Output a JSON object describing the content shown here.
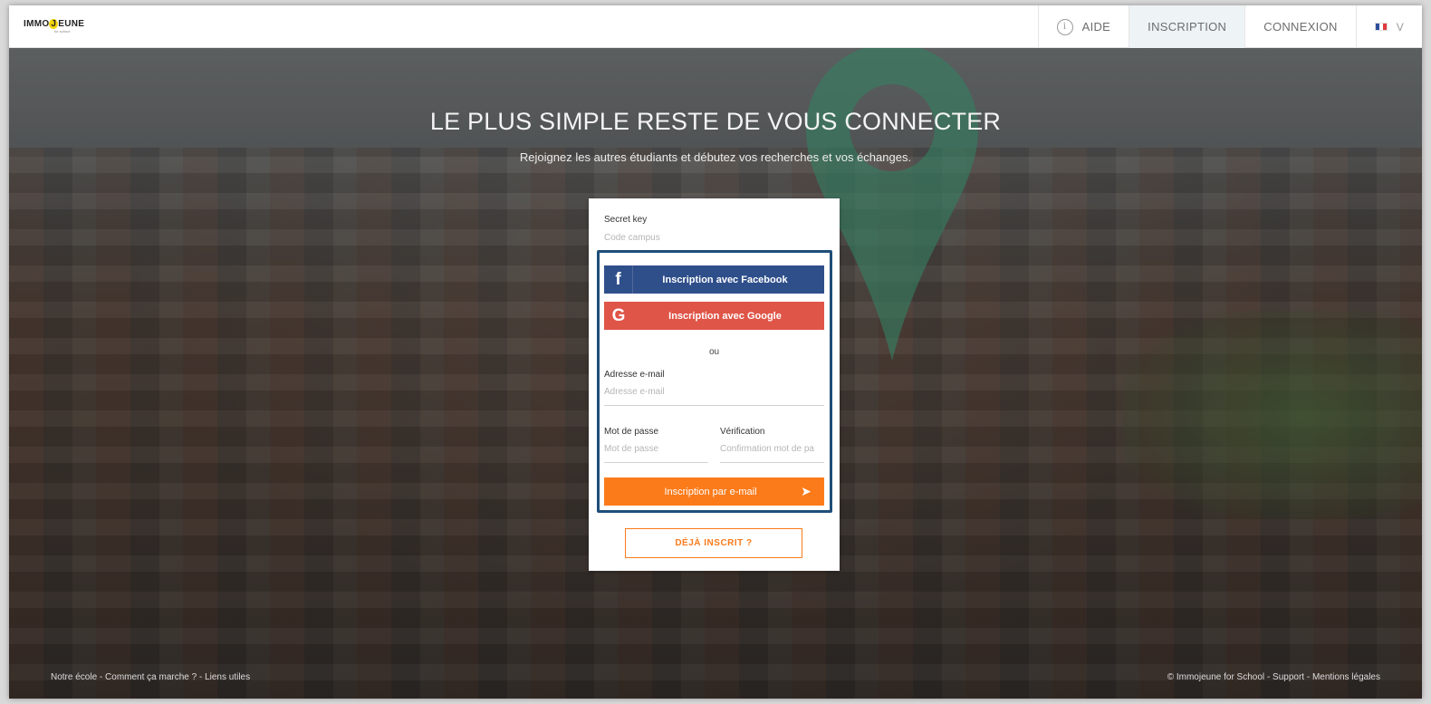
{
  "logo": {
    "text_pre": "IMMO",
    "text_j": "J",
    "text_post": "EUNE",
    "sub": "for school"
  },
  "nav": {
    "aide": "AIDE",
    "inscription": "INSCRIPTION",
    "connexion": "CONNEXION",
    "language_icon": "french-flag-icon",
    "chevron": "V"
  },
  "hero": {
    "title": "LE PLUS SIMPLE RESTE DE VOUS CONNECTER",
    "subtitle": "Rejoignez les autres étudiants et débutez vos recherches et vos échanges."
  },
  "form": {
    "secret_key_label": "Secret key",
    "secret_key_placeholder": "Code campus",
    "facebook_button": "Inscription avec Facebook",
    "facebook_icon": "f",
    "google_button": "Inscription avec Google",
    "google_icon": "G",
    "separator": "ou",
    "email_label": "Adresse e-mail",
    "email_placeholder": "Adresse e-mail",
    "password_label": "Mot de passe",
    "password_placeholder": "Mot de passe",
    "verification_label": "Vérification",
    "verification_placeholder": "Confirmation mot de pa",
    "email_button": "Inscription par e-mail",
    "email_button_arrow": "➤",
    "already_registered": "DÉJÀ INSCRIT ?"
  },
  "footer": {
    "left": [
      "Notre école",
      "Comment ça marche ?",
      "Liens utiles"
    ],
    "right": [
      "© Immojeune for School",
      "Support",
      "Mentions légales"
    ],
    "sep": " - "
  },
  "colors": {
    "facebook": "#2f4f8b",
    "google": "#df5547",
    "accent_orange": "#fb7b1b",
    "highlight_border": "#1f4e79"
  }
}
